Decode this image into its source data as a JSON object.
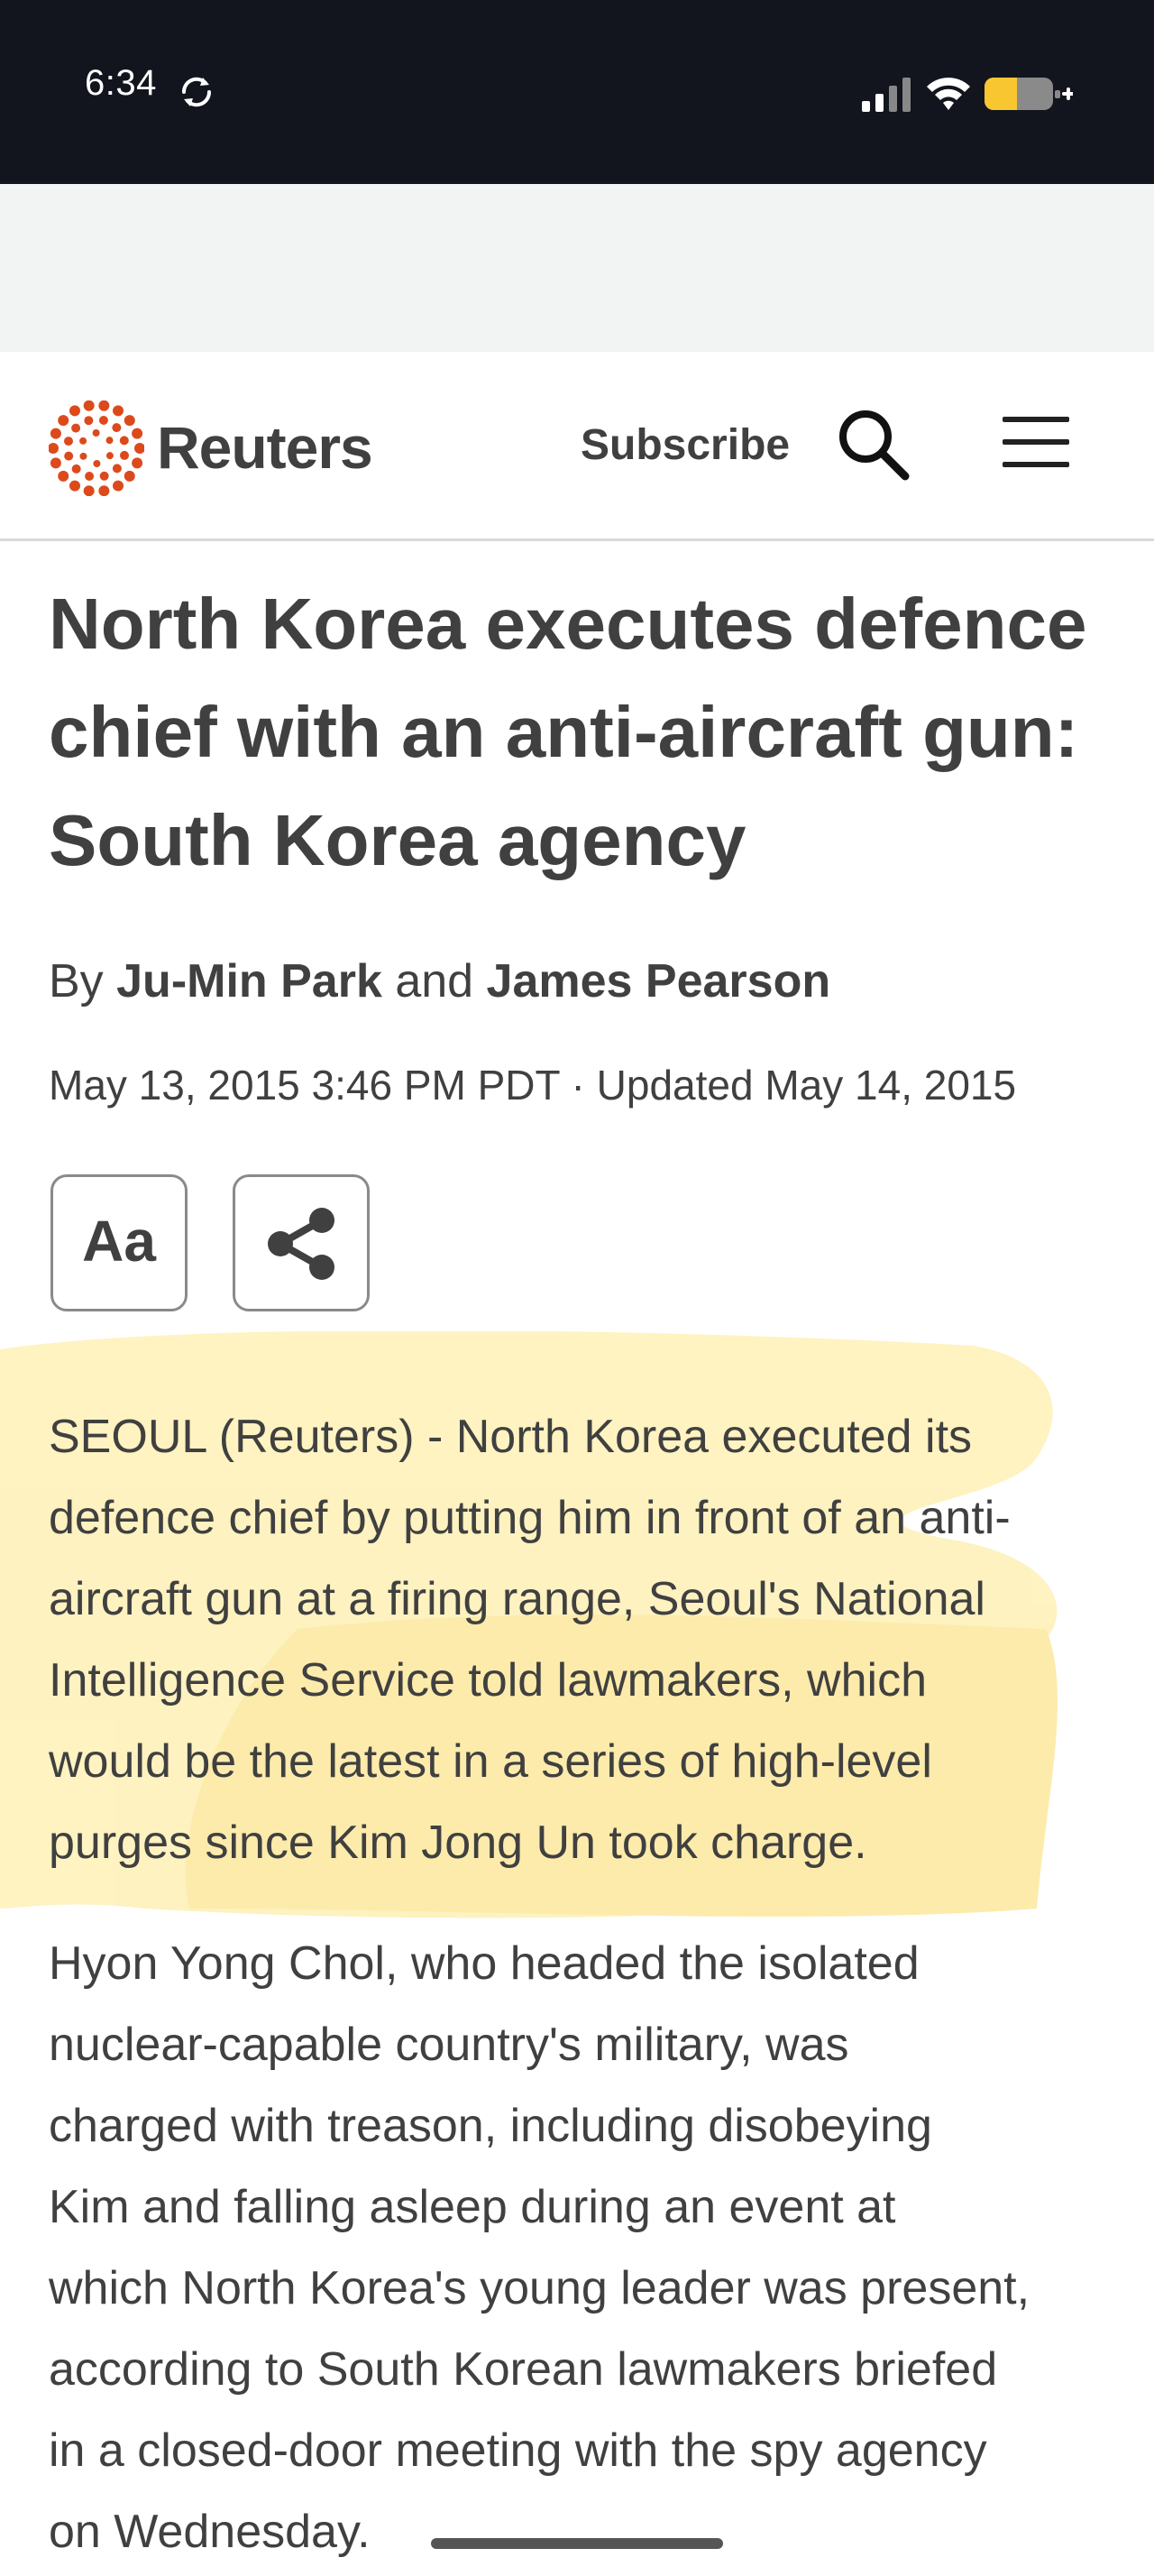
{
  "status_bar": {
    "time": "6:34",
    "icons": [
      "sync-icon",
      "cellular-signal-icon",
      "wifi-icon",
      "battery-charging-icon"
    ],
    "battery_color": "#f7c630"
  },
  "header": {
    "logo_text": "Reuters",
    "logo_color": "#dc4a1c",
    "subscribe_label": "Subscribe",
    "icons": [
      "search-icon",
      "hamburger-menu-icon"
    ]
  },
  "article": {
    "headline_lines": [
      "North Korea executes defence",
      "chief with an anti-aircraft gun:",
      "South Korea agency"
    ],
    "byline_prefix": "By",
    "author_1": "Ju-Min Park",
    "byline_and": "and",
    "author_2": "James Pearson",
    "dateline": "May 13, 2015 3:46 PM PDT · Updated May 14, 2015",
    "font_size_button_label": "Aa",
    "share_icon": "share-icon",
    "highlight_color": "#fde98e",
    "paragraph_1_lines": [
      "SEOUL (Reuters) - North Korea executed its",
      "defence chief by putting him in front of an anti-",
      "aircraft gun at a firing range, Seoul's National",
      "Intelligence Service told lawmakers, which",
      "would be the latest in a series of high-level",
      "purges since Kim Jong Un took charge."
    ],
    "paragraph_2_lines": [
      "Hyon Yong Chol, who headed the isolated",
      "nuclear-capable country's military, was",
      "charged with treason, including disobeying",
      "Kim and falling asleep during an event at",
      "which North Korea's young leader was present,",
      "according to South Korean lawmakers briefed",
      "in a closed-door meeting with the spy agency",
      "on Wednesday."
    ]
  }
}
